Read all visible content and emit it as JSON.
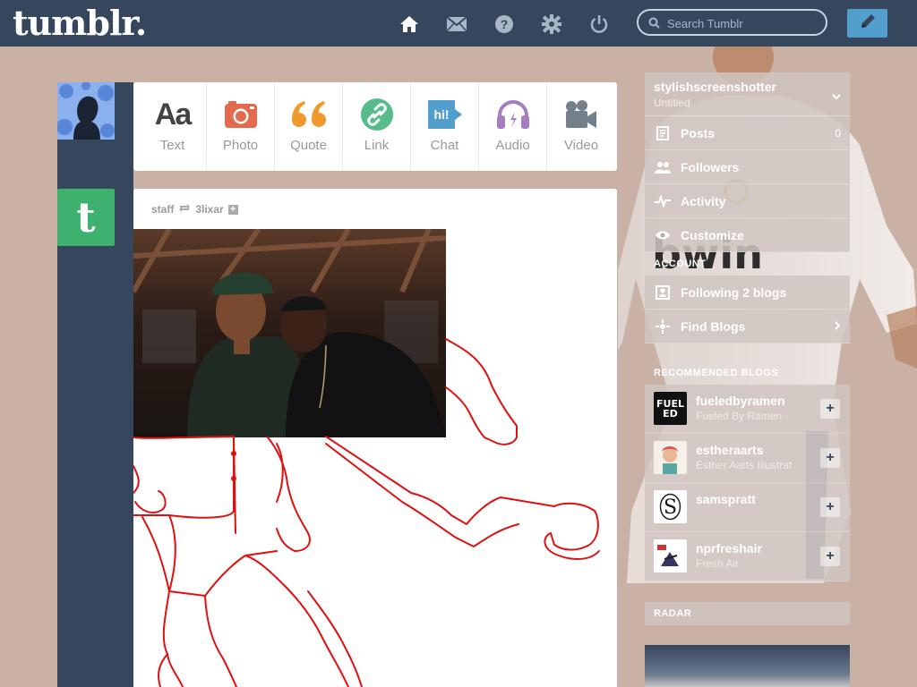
{
  "header": {
    "logo": "tumblr.",
    "search_placeholder": "Search Tumblr",
    "nav_icons": [
      "home-icon",
      "mail-icon",
      "help-icon",
      "settings-icon",
      "power-icon"
    ],
    "compose_icon": "pencil-icon"
  },
  "post_types": [
    {
      "label": "Text",
      "icon": "text-icon",
      "color": "#444444"
    },
    {
      "label": "Photo",
      "icon": "camera-icon",
      "color": "#e46a4d"
    },
    {
      "label": "Quote",
      "icon": "quote-icon",
      "color": "#f2992e"
    },
    {
      "label": "Link",
      "icon": "link-icon",
      "color": "#56bc8a"
    },
    {
      "label": "Chat",
      "icon": "chat-icon",
      "color": "#529ecc"
    },
    {
      "label": "Audio",
      "icon": "headphones-icon",
      "color": "#a77dc2"
    },
    {
      "label": "Video",
      "icon": "video-camera-icon",
      "color": "#748089"
    }
  ],
  "post": {
    "author": "staff",
    "reblogged_from": "3lixar",
    "follow_icon": "plus-icon"
  },
  "sidebar": {
    "blog_name": "stylishscreenshotter",
    "blog_title": "Untitled",
    "rows": [
      {
        "label": "Posts",
        "count": "0",
        "icon": "posts-icon"
      },
      {
        "label": "Followers",
        "count": "",
        "icon": "followers-icon"
      },
      {
        "label": "Activity",
        "count": "",
        "icon": "activity-icon"
      },
      {
        "label": "Customize",
        "count": "",
        "icon": "eye-icon"
      }
    ],
    "account_heading": "ACCOUNT",
    "account_rows": [
      {
        "label": "Following 2 blogs",
        "icon": "following-icon"
      },
      {
        "label": "Find Blogs",
        "icon": "find-blogs-icon"
      }
    ],
    "recommended_heading": "RECOMMENDED BLOGS",
    "recommended": [
      {
        "name": "fueledbyramen",
        "title": "Fueled By Ramen"
      },
      {
        "name": "estheraarts",
        "title": "Esther Aarts Illustrat"
      },
      {
        "name": "samspratt",
        "title": ""
      },
      {
        "name": "nprfreshair",
        "title": "Fresh Air"
      }
    ],
    "radar_heading": "RADAR"
  },
  "colors": {
    "background": "#c9b1a5",
    "nav": "#36465d",
    "compose": "#529ecc",
    "drawing_line": "#e01010"
  }
}
